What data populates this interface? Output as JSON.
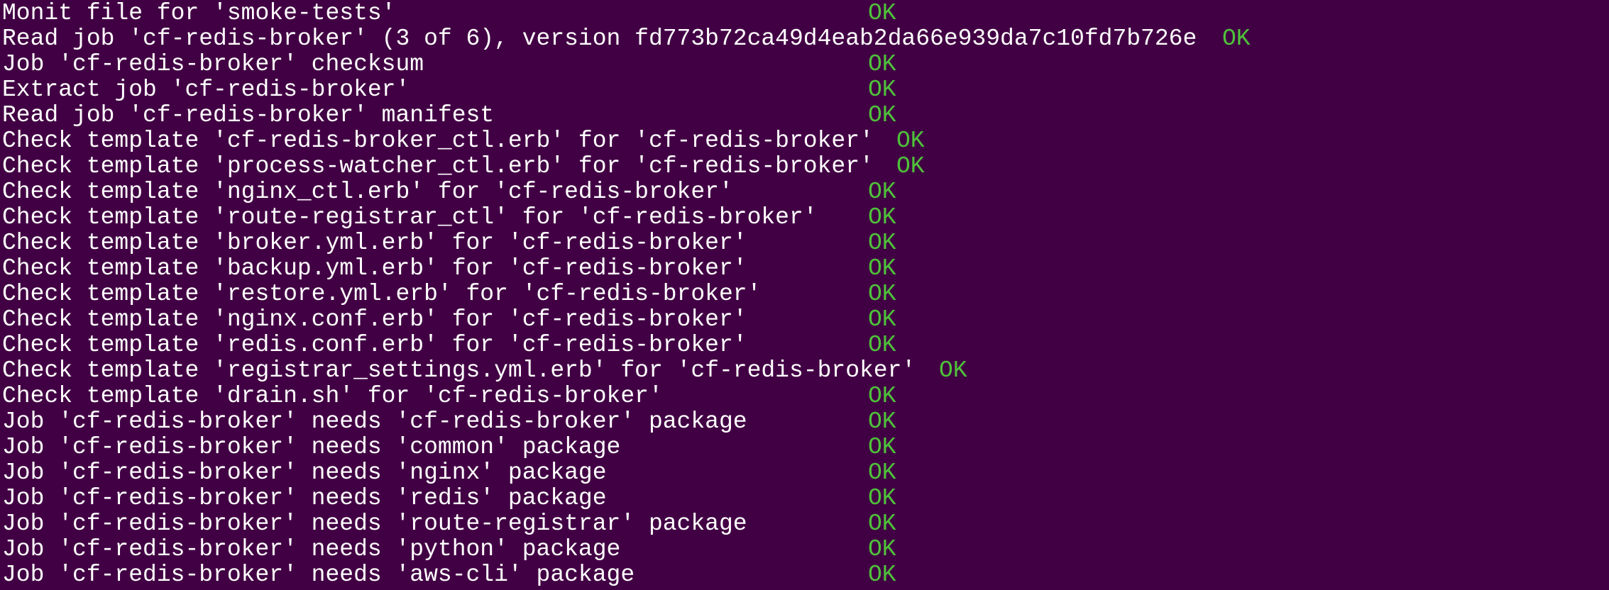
{
  "colors": {
    "background": "#420044",
    "text": "#ffffff",
    "ok": "#4ec23a"
  },
  "lines": [
    {
      "text": "Monit file for 'smoke-tests'",
      "status": "OK"
    },
    {
      "text": "Read job 'cf-redis-broker' (3 of 6), version fd773b72ca49d4eab2da66e939da7c10fd7b726e",
      "status": "OK"
    },
    {
      "text": "Job 'cf-redis-broker' checksum",
      "status": "OK"
    },
    {
      "text": "Extract job 'cf-redis-broker'",
      "status": "OK"
    },
    {
      "text": "Read job 'cf-redis-broker' manifest",
      "status": "OK"
    },
    {
      "text": "Check template 'cf-redis-broker_ctl.erb' for 'cf-redis-broker'",
      "status": "OK"
    },
    {
      "text": "Check template 'process-watcher_ctl.erb' for 'cf-redis-broker'",
      "status": "OK"
    },
    {
      "text": "Check template 'nginx_ctl.erb' for 'cf-redis-broker'",
      "status": "OK"
    },
    {
      "text": "Check template 'route-registrar_ctl' for 'cf-redis-broker'",
      "status": "OK"
    },
    {
      "text": "Check template 'broker.yml.erb' for 'cf-redis-broker'",
      "status": "OK"
    },
    {
      "text": "Check template 'backup.yml.erb' for 'cf-redis-broker'",
      "status": "OK"
    },
    {
      "text": "Check template 'restore.yml.erb' for 'cf-redis-broker'",
      "status": "OK"
    },
    {
      "text": "Check template 'nginx.conf.erb' for 'cf-redis-broker'",
      "status": "OK"
    },
    {
      "text": "Check template 'redis.conf.erb' for 'cf-redis-broker'",
      "status": "OK"
    },
    {
      "text": "Check template 'registrar_settings.yml.erb' for 'cf-redis-broker'",
      "status": "OK"
    },
    {
      "text": "Check template 'drain.sh' for 'cf-redis-broker'",
      "status": "OK"
    },
    {
      "text": "Job 'cf-redis-broker' needs 'cf-redis-broker' package",
      "status": "OK"
    },
    {
      "text": "Job 'cf-redis-broker' needs 'common' package",
      "status": "OK"
    },
    {
      "text": "Job 'cf-redis-broker' needs 'nginx' package",
      "status": "OK"
    },
    {
      "text": "Job 'cf-redis-broker' needs 'redis' package",
      "status": "OK"
    },
    {
      "text": "Job 'cf-redis-broker' needs 'route-registrar' package",
      "status": "OK"
    },
    {
      "text": "Job 'cf-redis-broker' needs 'python' package",
      "status": "OK"
    },
    {
      "text": "Job 'cf-redis-broker' needs 'aws-cli' package",
      "status": "OK"
    }
  ]
}
